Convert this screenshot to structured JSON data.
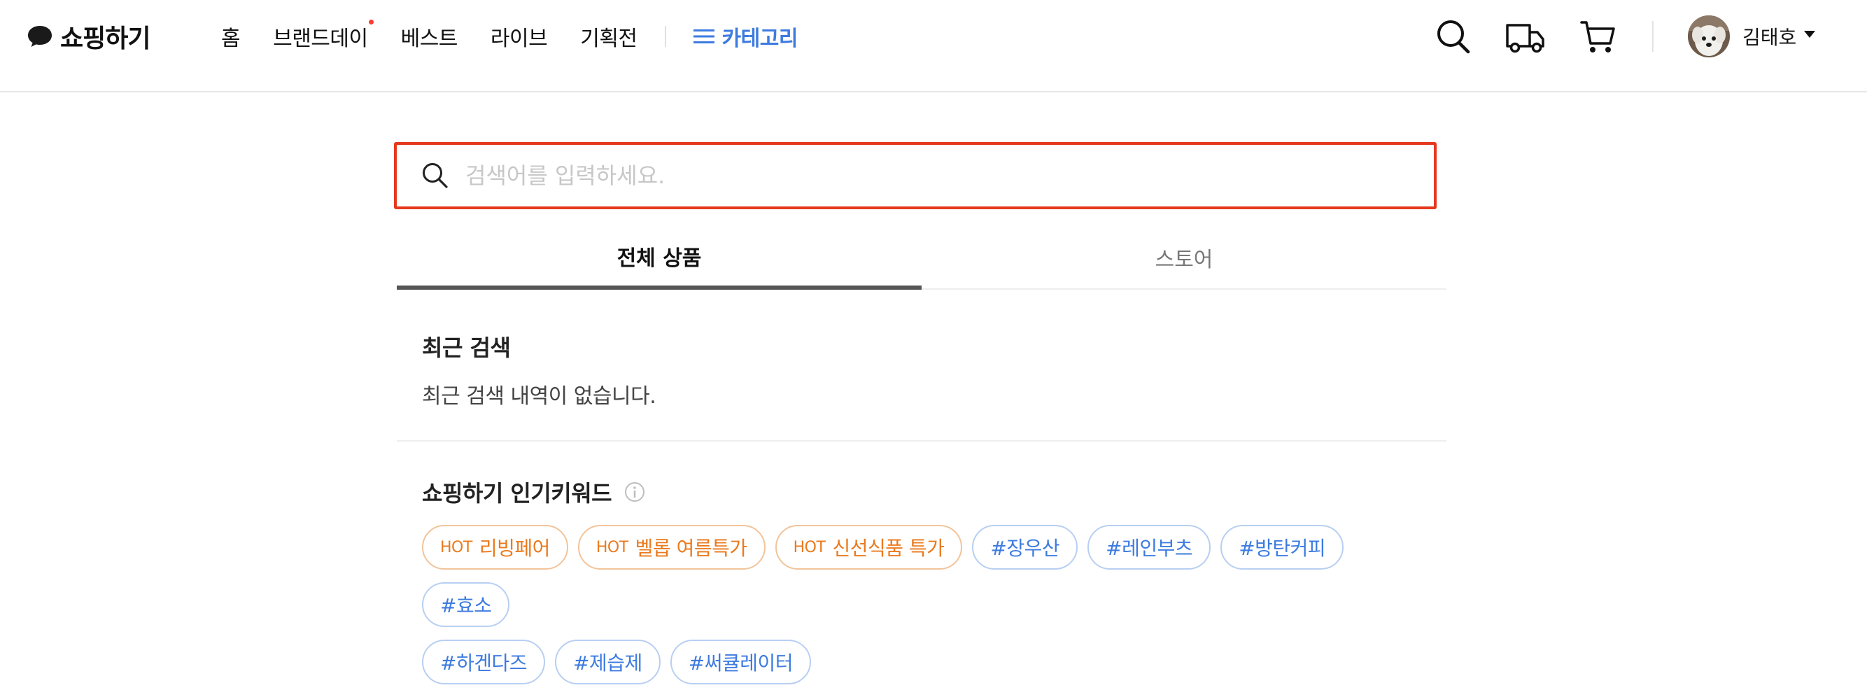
{
  "header": {
    "logo_text": "쇼핑하기",
    "nav": [
      {
        "label": "홈",
        "dot": false
      },
      {
        "label": "브랜드데이",
        "dot": true
      },
      {
        "label": "베스트",
        "dot": false
      },
      {
        "label": "라이브",
        "dot": false
      },
      {
        "label": "기획전",
        "dot": false
      }
    ],
    "category_label": "카테고리",
    "icons": [
      "search-icon",
      "truck-icon",
      "cart-icon"
    ],
    "user_name": "김태호"
  },
  "search": {
    "placeholder": "검색어를 입력하세요.",
    "value": ""
  },
  "tabs": [
    {
      "label": "전체 상품",
      "active": true
    },
    {
      "label": "스토어",
      "active": false
    }
  ],
  "recent": {
    "title": "최근 검색",
    "empty_text": "최근 검색 내역이 없습니다."
  },
  "popular": {
    "title": "쇼핑하기 인기키워드",
    "hot_badge": "HOT",
    "keywords": [
      {
        "type": "hot",
        "text": "리빙페어"
      },
      {
        "type": "hot",
        "text": "벨롭 여름특가"
      },
      {
        "type": "hot",
        "text": "신선식품 특가"
      },
      {
        "type": "tag",
        "text": "#장우산"
      },
      {
        "type": "tag",
        "text": "#레인부츠"
      },
      {
        "type": "tag",
        "text": "#방탄커피"
      },
      {
        "type": "tag",
        "text": "#효소"
      },
      {
        "type": "tag",
        "text": "#하겐다즈"
      },
      {
        "type": "tag",
        "text": "#제습제"
      },
      {
        "type": "tag",
        "text": "#써큘레이터"
      }
    ]
  },
  "colors": {
    "accent_blue": "#3d7be0",
    "hot_orange": "#ea7a1e",
    "search_border": "#e4391f",
    "nav_dot": "#ff3b30"
  }
}
